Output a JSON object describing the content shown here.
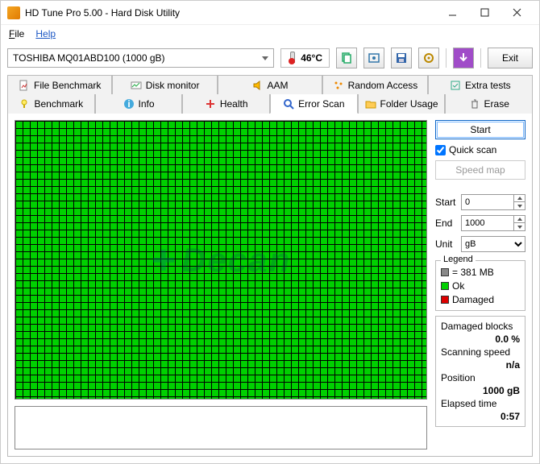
{
  "window": {
    "title": "HD Tune Pro 5.00 - Hard Disk Utility"
  },
  "menu": {
    "file": "File",
    "help": "Help"
  },
  "toolbar": {
    "drive": "TOSHIBA MQ01ABD100 (1000 gB)",
    "temp": "46°C",
    "exit": "Exit"
  },
  "tabs_row1": [
    {
      "label": "File Benchmark",
      "icon": "file-benchmark-icon"
    },
    {
      "label": "Disk monitor",
      "icon": "disk-monitor-icon"
    },
    {
      "label": "AAM",
      "icon": "speaker-icon"
    },
    {
      "label": "Random Access",
      "icon": "random-icon"
    },
    {
      "label": "Extra tests",
      "icon": "extra-icon"
    }
  ],
  "tabs_row2": [
    {
      "label": "Benchmark",
      "icon": "bulb-icon"
    },
    {
      "label": "Info",
      "icon": "info-icon"
    },
    {
      "label": "Health",
      "icon": "plus-icon"
    },
    {
      "label": "Error Scan",
      "icon": "magnifier-icon",
      "active": true
    },
    {
      "label": "Folder Usage",
      "icon": "folder-icon"
    },
    {
      "label": "Erase",
      "icon": "trash-icon"
    }
  ],
  "controls": {
    "start": "Start",
    "quick_scan": "Quick scan",
    "speed_map": "Speed map",
    "start_label": "Start",
    "start_value": "0",
    "end_label": "End",
    "end_value": "1000",
    "unit_label": "Unit",
    "unit_value": "gB"
  },
  "legend": {
    "title": "Legend",
    "block": "= 381 MB",
    "ok": "Ok",
    "damaged": "Damaged"
  },
  "stats": {
    "damaged_label": "Damaged blocks",
    "damaged_value": "0.0 %",
    "speed_label": "Scanning speed",
    "speed_value": "n/a",
    "position_label": "Position",
    "position_value": "1000 gB",
    "elapsed_label": "Elapsed time",
    "elapsed_value": "0:57"
  }
}
